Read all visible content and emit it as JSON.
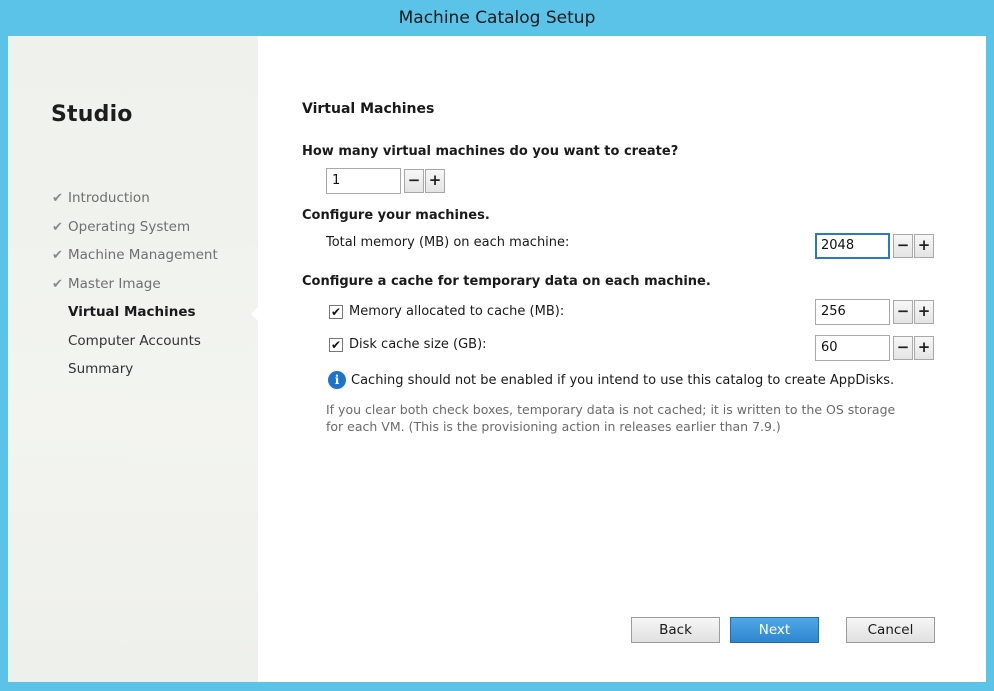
{
  "window": {
    "title": "Machine Catalog Setup"
  },
  "sidebar": {
    "brand": "Studio",
    "steps": [
      {
        "label": "Introduction",
        "state": "done"
      },
      {
        "label": "Operating System",
        "state": "done"
      },
      {
        "label": "Machine Management",
        "state": "done"
      },
      {
        "label": "Master Image",
        "state": "done"
      },
      {
        "label": "Virtual Machines",
        "state": "current"
      },
      {
        "label": "Computer Accounts",
        "state": "pending"
      },
      {
        "label": "Summary",
        "state": "pending"
      }
    ],
    "check_glyph": "✔"
  },
  "main": {
    "title": "Virtual Machines",
    "vm_count": {
      "question": "How many virtual machines do you want to create?",
      "value": "1",
      "minus": "−",
      "plus": "+"
    },
    "configure": {
      "heading": "Configure your machines.",
      "memory_label": "Total memory (MB) on each machine:",
      "memory_value": "2048"
    },
    "cache": {
      "heading": "Configure a cache for temporary data on each machine.",
      "memory_cache": {
        "checked": true,
        "label": "Memory allocated to cache (MB):",
        "value": "256"
      },
      "disk_cache": {
        "checked": true,
        "label": "Disk cache size (GB):",
        "value": "60"
      },
      "info_icon": "i",
      "warning": "Caching should not be enabled if you intend to use this catalog to create AppDisks.",
      "note_line1": "If you clear both check boxes, temporary data is not cached; it is written to the OS storage",
      "note_line2": "for each VM. (This is the provisioning action in releases earlier than 7.9.)"
    }
  },
  "buttons": {
    "back": "Back",
    "next": "Next",
    "cancel": "Cancel"
  },
  "colors": {
    "titlebar": "#5bc3e8",
    "accent": "#2f86cf",
    "focus": "#2a78c6"
  }
}
